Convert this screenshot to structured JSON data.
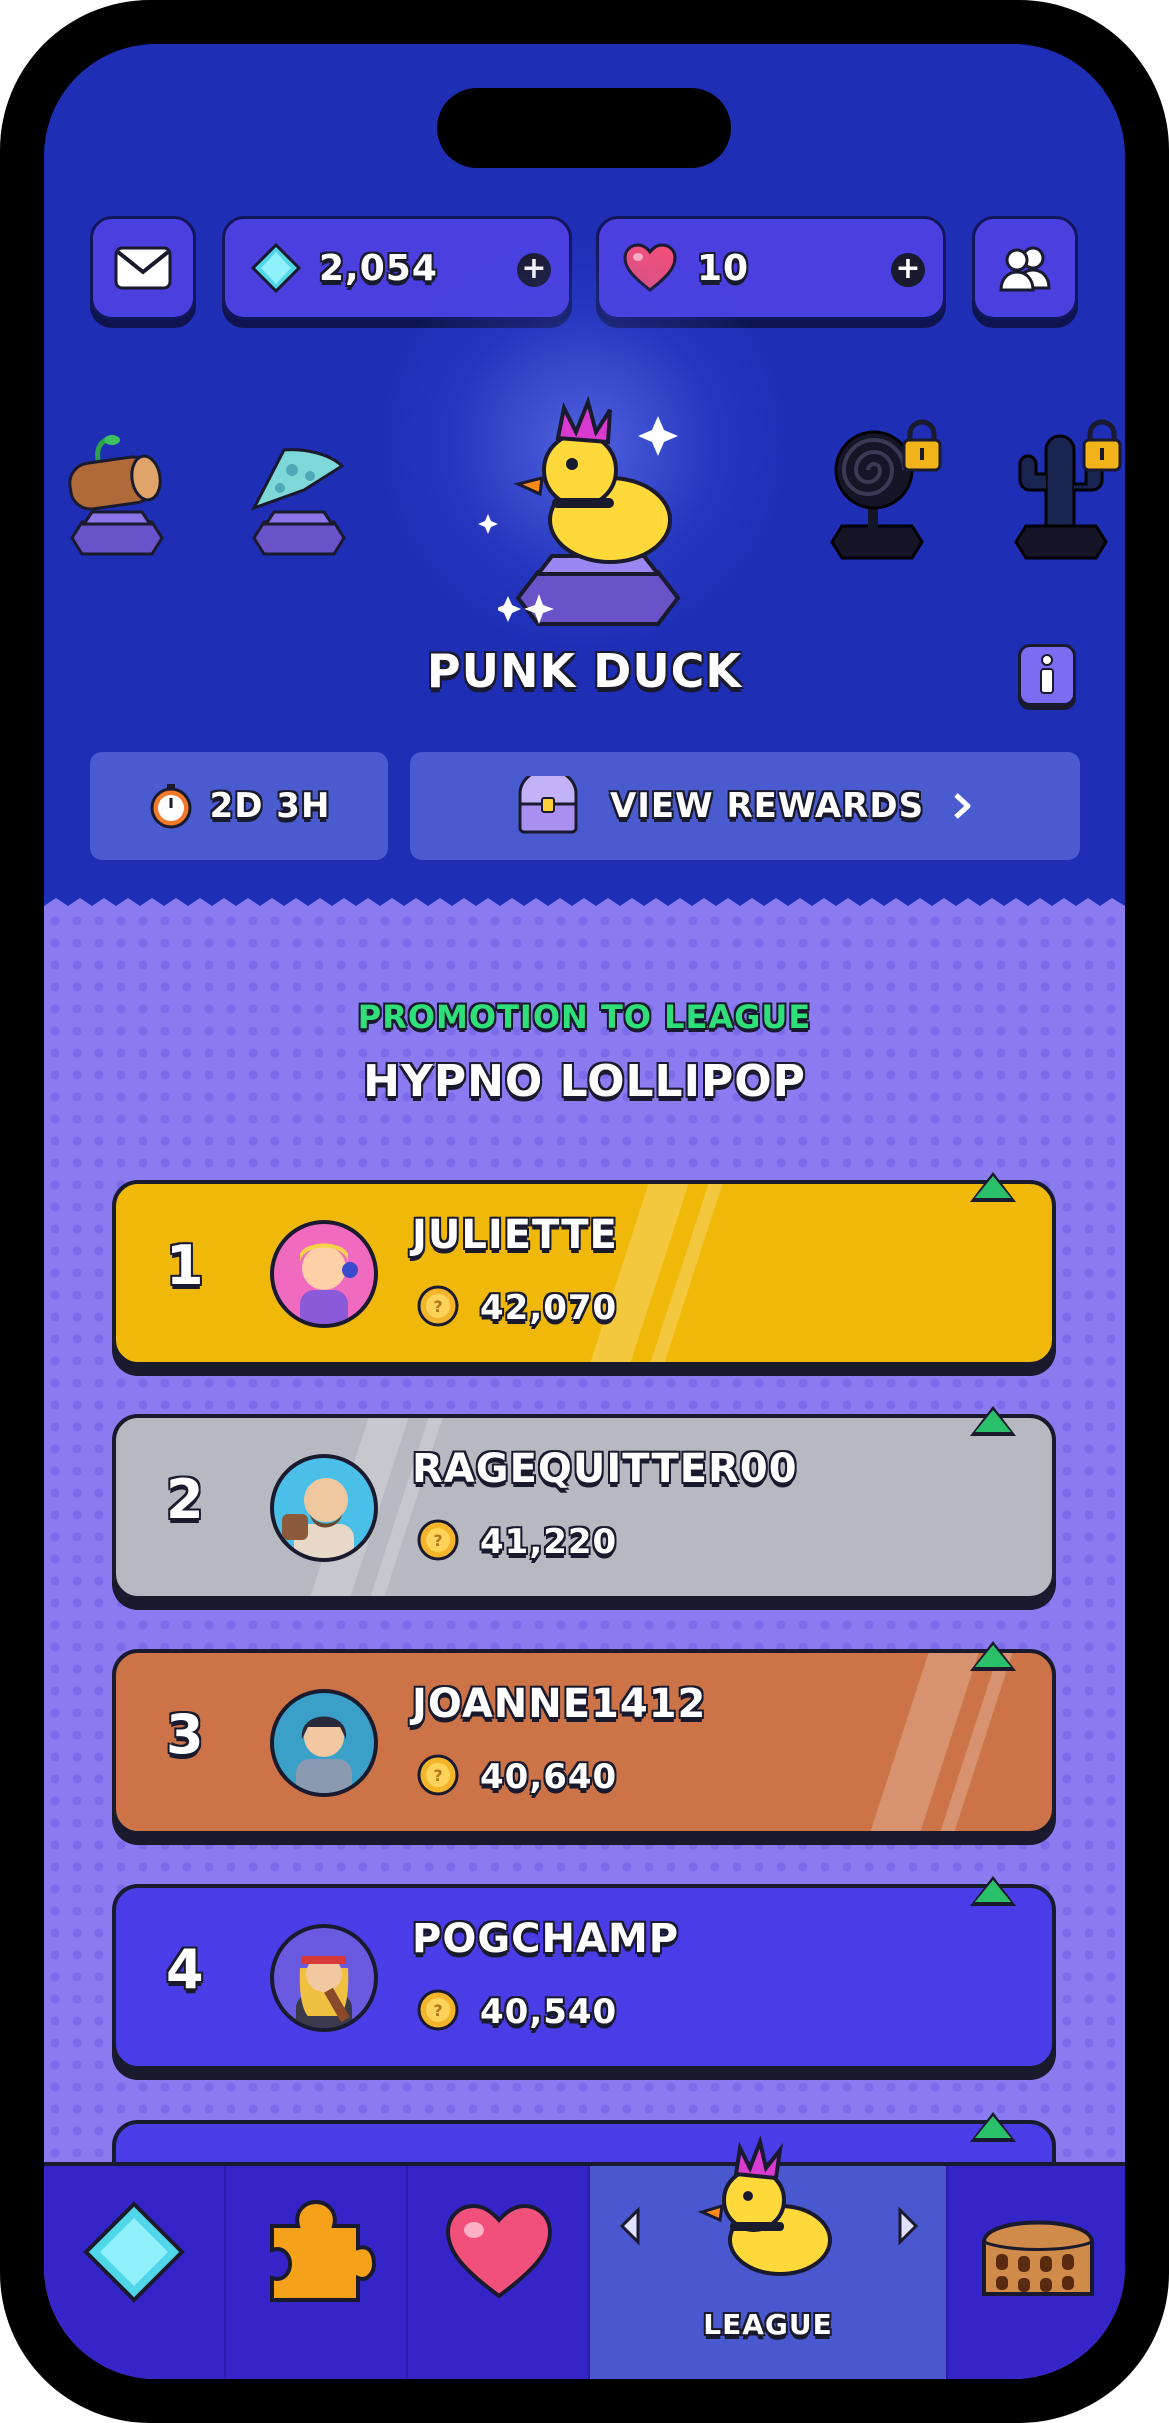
{
  "topbar": {
    "gems": "2,054",
    "lives": "10"
  },
  "current_league": {
    "title": "PUNK DUCK",
    "timer": "2D 3H",
    "view_rewards": "VIEW REWARDS"
  },
  "promotion": {
    "heading": "PROMOTION TO LEAGUE",
    "next_league": "HYPNO LOLLIPOP"
  },
  "leaderboard": [
    {
      "rank": "1",
      "name": "JULIETTE",
      "score": "42,070",
      "color": "#f0b90a"
    },
    {
      "rank": "2",
      "name": "RAGEQUITTER00",
      "score": "41,220",
      "color": "#b7b9c1"
    },
    {
      "rank": "3",
      "name": "JOANNE1412",
      "score": "40,640",
      "color": "#cc7448"
    },
    {
      "rank": "4",
      "name": "POGCHAMP",
      "score": "40,540",
      "color": "#4a3de8"
    }
  ],
  "nav": {
    "league_label": "LEAGUE"
  },
  "colors": {
    "background": "#1e2eb5",
    "lower": "#8a7cf0",
    "promo_green": "#2fe07a"
  }
}
